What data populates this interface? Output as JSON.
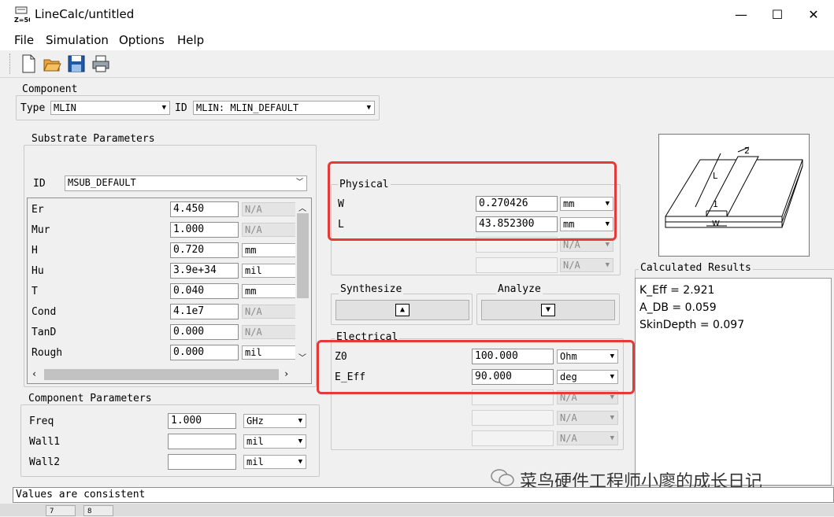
{
  "window": {
    "title": "LineCalc/untitled",
    "minimize": "—",
    "maximize": "☐",
    "close": "✕"
  },
  "menu": [
    "File",
    "Simulation",
    "Options",
    "Help"
  ],
  "component": {
    "legend": "Component",
    "type_label": "Type",
    "type_value": "MLIN",
    "id_label": "ID",
    "id_value": "MLIN: MLIN_DEFAULT"
  },
  "substrate": {
    "legend": "Substrate Parameters",
    "id_label": "ID",
    "id_value": "MSUB_DEFAULT",
    "rows": [
      {
        "name": "Er",
        "value": "4.450",
        "unit": "N/A",
        "enabled": false
      },
      {
        "name": "Mur",
        "value": "1.000",
        "unit": "N/A",
        "enabled": false
      },
      {
        "name": "H",
        "value": "0.720",
        "unit": "mm",
        "enabled": true
      },
      {
        "name": "Hu",
        "value": "3.9e+34",
        "unit": "mil",
        "enabled": true
      },
      {
        "name": "T",
        "value": "0.040",
        "unit": "mm",
        "enabled": true
      },
      {
        "name": "Cond",
        "value": "4.1e7",
        "unit": "N/A",
        "enabled": false
      },
      {
        "name": "TanD",
        "value": "0.000",
        "unit": "N/A",
        "enabled": false
      },
      {
        "name": "Rough",
        "value": "0.000",
        "unit": "mil",
        "enabled": true
      }
    ]
  },
  "component_params": {
    "legend": "Component Parameters",
    "rows": [
      {
        "name": "Freq",
        "value": "1.000",
        "unit": "GHz"
      },
      {
        "name": "Wall1",
        "value": "",
        "unit": "mil"
      },
      {
        "name": "Wall2",
        "value": "",
        "unit": "mil"
      }
    ]
  },
  "physical": {
    "legend": "Physical",
    "rows": [
      {
        "name": "W",
        "value": "0.270426",
        "unit": "mm"
      },
      {
        "name": "L",
        "value": "43.852300",
        "unit": "mm"
      }
    ],
    "disabled_unit": "N/A"
  },
  "synthesize": {
    "label": "Synthesize",
    "arrow": "▲"
  },
  "analyze": {
    "label": "Analyze",
    "arrow": "▼"
  },
  "electrical": {
    "legend": "Electrical",
    "rows": [
      {
        "name": "Z0",
        "value": "100.000",
        "unit": "Ohm"
      },
      {
        "name": "E_Eff",
        "value": "90.000",
        "unit": "deg"
      }
    ],
    "disabled_unit": "N/A"
  },
  "diagram": {
    "label_1": "1",
    "label_2": "2",
    "label_L": "L",
    "label_W": "W"
  },
  "results": {
    "legend": "Calculated Results",
    "lines": [
      "K_Eff = 2.921",
      "A_DB = 0.059",
      "SkinDepth = 0.097"
    ]
  },
  "status": "Values are consistent",
  "watermark": "菜鸟硬件工程师小廖的成长日记",
  "taskbar": {
    "item_1": "7",
    "item_2": "8"
  },
  "colors": {
    "highlight_box": "#e53a3a",
    "title_bg": "#ffffff",
    "window_bg": "#f0f0f0"
  }
}
